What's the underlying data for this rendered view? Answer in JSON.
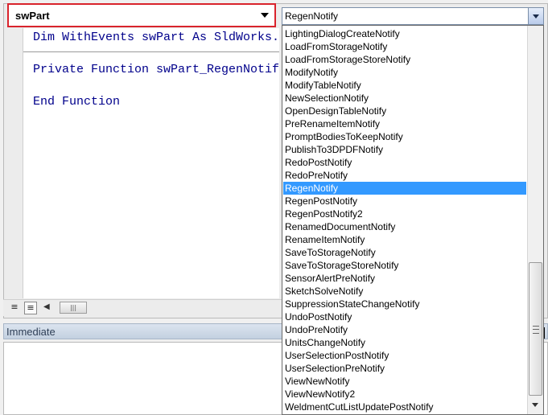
{
  "object_combo": {
    "value": "swPart"
  },
  "procedure_combo": {
    "value": "RegenNotify"
  },
  "code": {
    "lines": [
      "Dim WithEvents swPart As SldWorks.PartDoc",
      "Private Function swPart_RegenNotify() As Integer",
      "End Function"
    ]
  },
  "immediate": {
    "title": "Immediate"
  },
  "dropdown": {
    "selected_index": 12,
    "items": [
      "LightingDialogCreateNotify",
      "LoadFromStorageNotify",
      "LoadFromStorageStoreNotify",
      "ModifyNotify",
      "ModifyTableNotify",
      "NewSelectionNotify",
      "OpenDesignTableNotify",
      "PreRenameItemNotify",
      "PromptBodiesToKeepNotify",
      "PublishTo3DPDFNotify",
      "RedoPostNotify",
      "RedoPreNotify",
      "RegenNotify",
      "RegenPostNotify",
      "RegenPostNotify2",
      "RenamedDocumentNotify",
      "RenameItemNotify",
      "SaveToStorageNotify",
      "SaveToStorageStoreNotify",
      "SensorAlertPreNotify",
      "SketchSolveNotify",
      "SuppressionStateChangeNotify",
      "UndoPostNotify",
      "UndoPreNotify",
      "UnitsChangeNotify",
      "UserSelectionPostNotify",
      "UserSelectionPreNotify",
      "ViewNewNotify",
      "ViewNewNotify2",
      "WeldmentCutListUpdatePostNotify"
    ]
  }
}
